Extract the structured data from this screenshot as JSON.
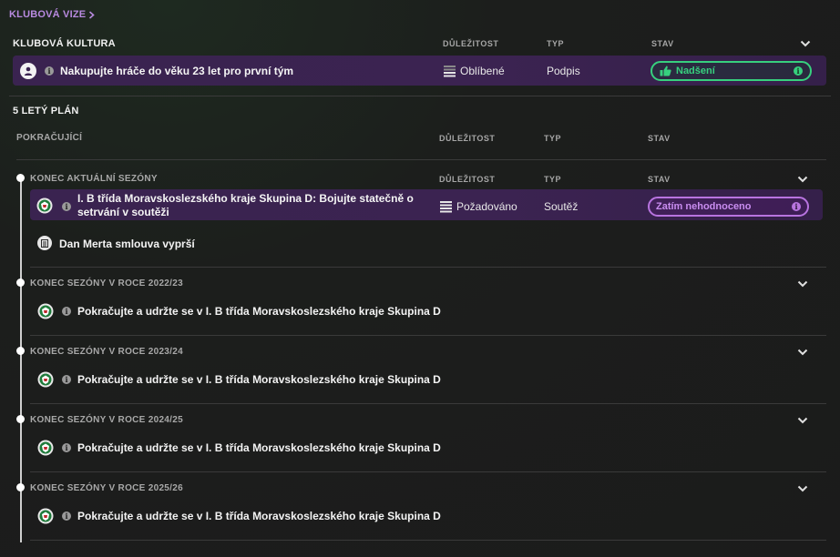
{
  "breadcrumb": {
    "label": "KLUBOVÁ VIZE"
  },
  "club_culture": {
    "title": "KLUBOVÁ KULTURA",
    "col_importance": "DŮLEŽITOST",
    "col_type": "TYP",
    "col_status": "STAV",
    "row": {
      "text": "Nakupujte hráče do věku 23 let pro první tým",
      "importance": "Oblíbené",
      "type": "Podpis",
      "status": "Nadšení",
      "status_color": "#37d07e"
    }
  },
  "plan": {
    "title": "5 LETÝ PLÁN",
    "ongoing_label": "POKRAČUJÍCÍ",
    "col_importance": "DŮLEŽITOST",
    "col_type": "TYP",
    "col_status": "STAV",
    "groups": [
      {
        "heading": "KONEC AKTUÁLNÍ SEZÓNY",
        "col_importance": "DŮLEŽITOST",
        "col_type": "TYP",
        "col_status": "STAV",
        "objective": {
          "text_line1": "I. B třída Moravskoslezského kraje Skupina D: Bojujte statečně o",
          "text_line2": "setrvání v soutěži",
          "importance": "Požadováno",
          "type": "Soutěž",
          "status": "Zatím nehodnoceno",
          "status_color": "#b874e0"
        },
        "note": "Dan Merta smlouva vyprší"
      },
      {
        "heading": "KONEC SEZÓNY V ROCE 2022/23",
        "objective": "Pokračujte a udržte se v I. B třída Moravskoslezského kraje Skupina D"
      },
      {
        "heading": "KONEC SEZÓNY V ROCE 2023/24",
        "objective": "Pokračujte a udržte se v I. B třída Moravskoslezského kraje Skupina D"
      },
      {
        "heading": "KONEC SEZÓNY V ROCE 2024/25",
        "objective": "Pokračujte a udržte se v I. B třída Moravskoslezského kraje Skupina D"
      },
      {
        "heading": "KONEC SEZÓNY V ROCE 2025/26",
        "objective": "Pokračujte a udržte se v I. B třída Moravskoslezského kraje Skupina D"
      }
    ]
  },
  "icons": {
    "breadcrumb_chevron": "chevron-right-icon",
    "collapse": "chevron-down-icon",
    "person": "person-icon",
    "info": "info-icon",
    "importance": "importance-bars-icon",
    "thumbs_up": "thumbs-up-icon",
    "club_logo": "club-crest-icon",
    "document": "document-icon"
  },
  "colors": {
    "accent_purple": "#b88ae0",
    "row_highlight": "#3a2350",
    "success": "#37d07e"
  }
}
